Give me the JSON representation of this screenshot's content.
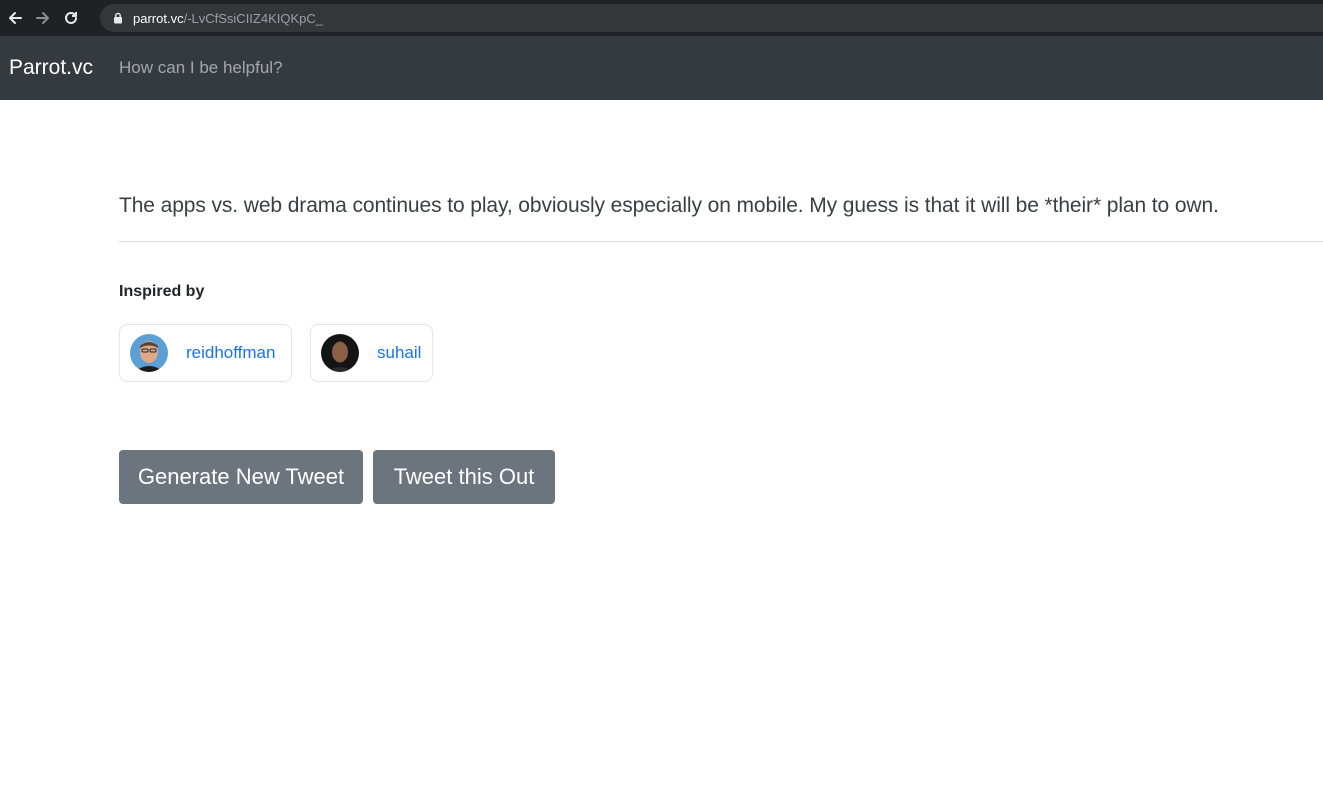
{
  "browser": {
    "url_domain": "parrot.vc",
    "url_path": "/-LvCfSsiCIIZ4KIQKpC_"
  },
  "navbar": {
    "brand": "Parrot.vc",
    "link": "How can I be helpful?"
  },
  "tweet": {
    "text": "The apps vs. web drama continues to play, obviously especially on mobile. My guess is that it will be *their* plan to own."
  },
  "inspired": {
    "heading": "Inspired by",
    "people": [
      {
        "handle": "reidhoffman"
      },
      {
        "handle": "suhail"
      }
    ]
  },
  "actions": {
    "generate_label": "Generate New Tweet",
    "tweet_label": "Tweet this Out"
  },
  "colors": {
    "navbar_bg": "#343a40",
    "button_bg": "#6c757d",
    "link": "#1a73e8"
  },
  "icons": {
    "back": "arrow-left-icon",
    "forward": "arrow-right-icon",
    "reload": "reload-icon",
    "lock": "lock-icon"
  }
}
